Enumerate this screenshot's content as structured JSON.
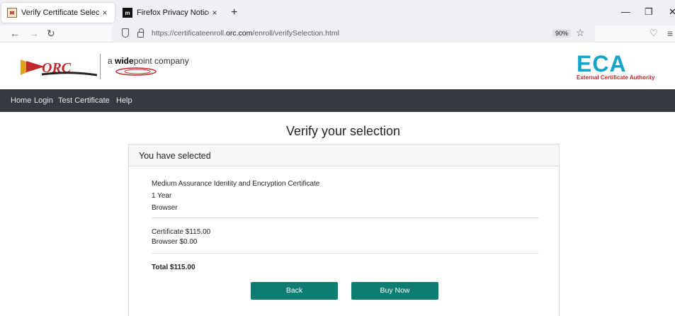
{
  "browser": {
    "tabs": [
      {
        "title": "Verify Certificate Selection",
        "active": true
      },
      {
        "title": "Firefox Privacy Notice — Mozill",
        "active": false
      }
    ],
    "new_tab": "+",
    "close": "×",
    "url_prefix": "https://certificateenroll.",
    "url_domain": "orc.com",
    "url_suffix": "/enroll/verifySelection.html",
    "zoom": "90%"
  },
  "header": {
    "company_prefix": "a ",
    "company_bold": "wide",
    "company_rest": "point company",
    "eca_title": "ECA",
    "eca_subtitle": "External Certificate Authority",
    "orc_logo": "ORC"
  },
  "nav": {
    "items": [
      "Home",
      "Login",
      "Test Certificate",
      "Help"
    ]
  },
  "main": {
    "title": "Verify your selection",
    "card_header": "You have selected",
    "selection": {
      "product": "Medium Assurance Identity and Encryption Certificate",
      "term": "1 Year",
      "type": "Browser"
    },
    "pricing": {
      "certificate": "Certificate $115.00",
      "browser": "Browser $0.00"
    },
    "total": "Total $115.00",
    "back_label": "Back",
    "buy_label": "Buy Now"
  },
  "colors": {
    "nav_bg": "#343a40",
    "button": "#0e7c70",
    "eca_blue": "#13a4c8",
    "eca_red": "#c0282b"
  }
}
